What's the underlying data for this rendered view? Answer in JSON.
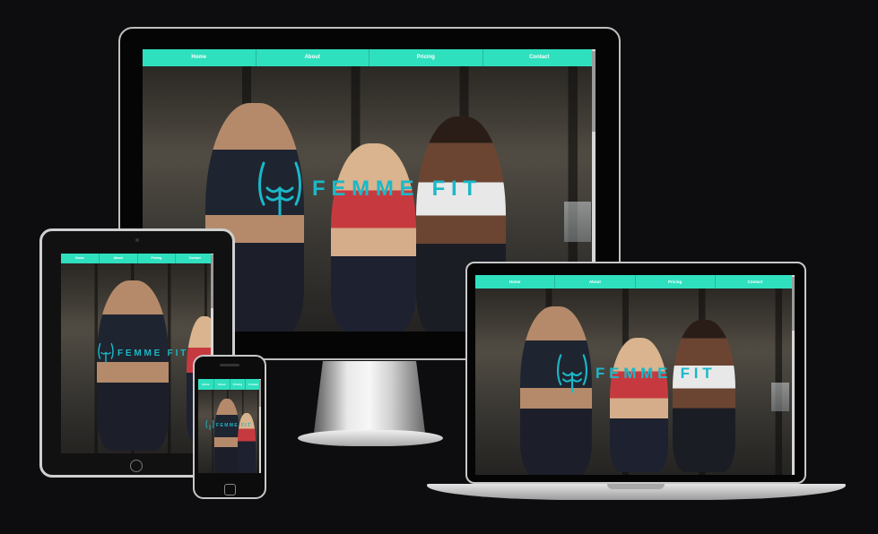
{
  "nav": {
    "home": "Home",
    "about": "About",
    "pricing": "Pricing",
    "contact": "Contact"
  },
  "brand": {
    "name": "FEMME FIT"
  },
  "colors": {
    "nav_bar": "#2fe0bf",
    "logo": "#1bb8c9",
    "background": "#0d0c0e"
  },
  "icons": {
    "logo": "torso-outline-icon"
  }
}
